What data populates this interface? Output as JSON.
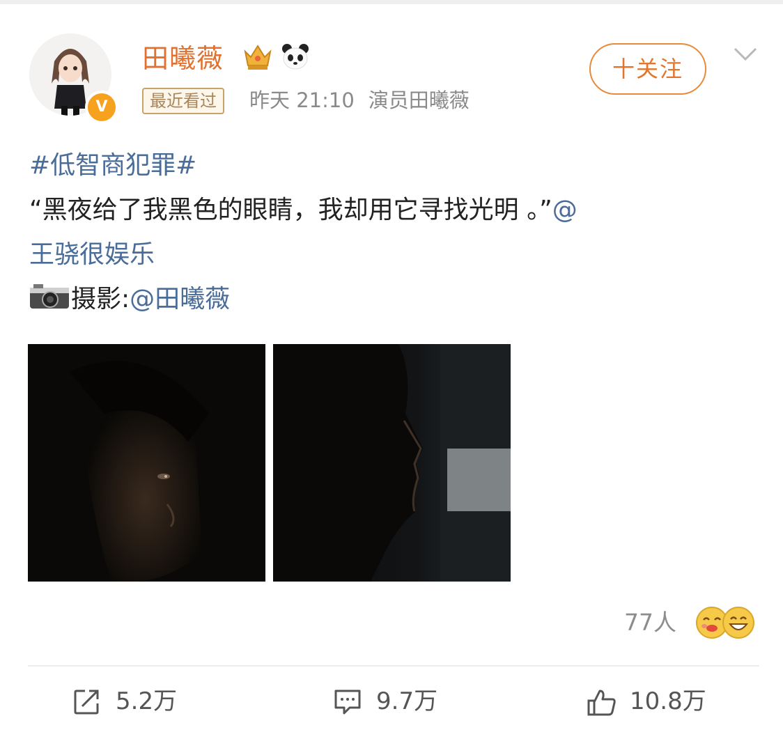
{
  "post": {
    "author": {
      "name": "田曦薇",
      "verified_badge": "V",
      "recent_tag": "最近看过",
      "time": "昨天 21:10",
      "source": "演员田曦薇"
    },
    "follow_label": "十关注",
    "hashtag": "#低智商犯罪#",
    "text_line1": "“黑夜给了我黑色的眼睛，我却用它寻找光明 。”",
    "mention_at": "@",
    "mention_name": "王骁很娱乐",
    "photo_label": "摄影:",
    "photo_mention": "@田曦薇",
    "likers": "77人",
    "actions": {
      "repost_count": "5.2万",
      "comment_count": "9.7万",
      "like_count": "10.8万"
    },
    "icons": [
      "crown-badge-icon",
      "panda-icon",
      "chevron-down-icon",
      "camera-icon",
      "repost-icon",
      "comment-icon",
      "thumbs-up-icon",
      "emoji-icon"
    ]
  },
  "colors": {
    "name": "#e2712f",
    "link": "#4a6c98",
    "follow": "#e3762d",
    "meta": "#8a8a8a"
  }
}
